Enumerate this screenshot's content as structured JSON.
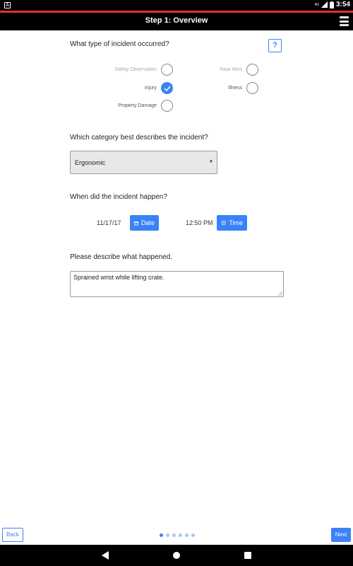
{
  "status_bar": {
    "time": "3:54",
    "network": "4G"
  },
  "header": {
    "title": "Step 1: Overview"
  },
  "q1": {
    "question": "What type of incident occurred?",
    "help_label": "?",
    "options": [
      {
        "label": "Safety Observation",
        "checked": false
      },
      {
        "label": "Near Miss",
        "checked": false
      },
      {
        "label": "Injury",
        "checked": true
      },
      {
        "label": "Illness",
        "checked": false
      },
      {
        "label": "Property Damage",
        "checked": false
      }
    ]
  },
  "q2": {
    "question": "Which category best describes the incident?",
    "selected": "Ergonomic"
  },
  "q3": {
    "question": "When did the incident happen?",
    "date_value": "11/17/17",
    "date_button": "Date",
    "time_value": "12:50 PM",
    "time_button": "Time"
  },
  "q4": {
    "question": "Please describe what happened.",
    "value": "Sprained wrist while lifting crate."
  },
  "footer": {
    "back_label": "Back",
    "next_label": "Next",
    "current_step": 1,
    "total_steps": 6
  },
  "colors": {
    "accent": "#3b82f6",
    "header_bg": "#000000",
    "header_stripe": "#e53030"
  },
  "icons": [
    "notification-icon",
    "signal-icon",
    "battery-icon",
    "menu-icon",
    "check-icon",
    "calendar-icon",
    "alarm-clock-icon",
    "nav-back-icon",
    "nav-home-icon",
    "nav-recent-icon"
  ]
}
